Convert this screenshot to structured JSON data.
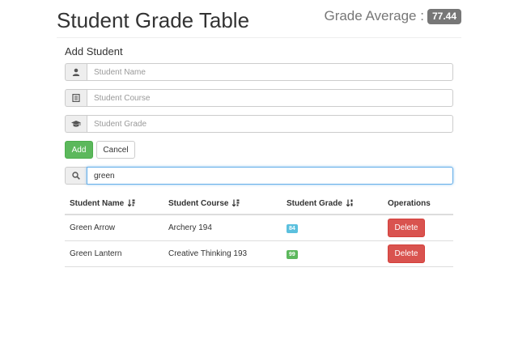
{
  "header": {
    "title": "Student Grade Table",
    "average_label": "Grade Average :",
    "average_value": "77.44"
  },
  "form": {
    "section_title": "Add Student",
    "name_placeholder": "Student Name",
    "course_placeholder": "Student Course",
    "grade_placeholder": "Student Grade",
    "add_label": "Add",
    "cancel_label": "Cancel",
    "icons": [
      "user-icon",
      "list-icon",
      "graduation-cap-icon"
    ]
  },
  "search": {
    "value": "green",
    "icon": "search-icon"
  },
  "table": {
    "headers": {
      "name": "Student Name",
      "course": "Student Course",
      "grade": "Student Grade",
      "operations": "Operations"
    },
    "rows": [
      {
        "name": "Green Arrow",
        "course": "Archery 194",
        "grade": "84",
        "grade_color": "#5bc0de",
        "delete_label": "Delete"
      },
      {
        "name": "Green Lantern",
        "course": "Creative Thinking 193",
        "grade": "99",
        "grade_color": "#5cb85c",
        "delete_label": "Delete"
      }
    ]
  },
  "colors": {
    "add_button": "#5cb85c",
    "delete_button": "#d9534f",
    "average_badge": "#777777",
    "focus_border": "#66afe9"
  }
}
